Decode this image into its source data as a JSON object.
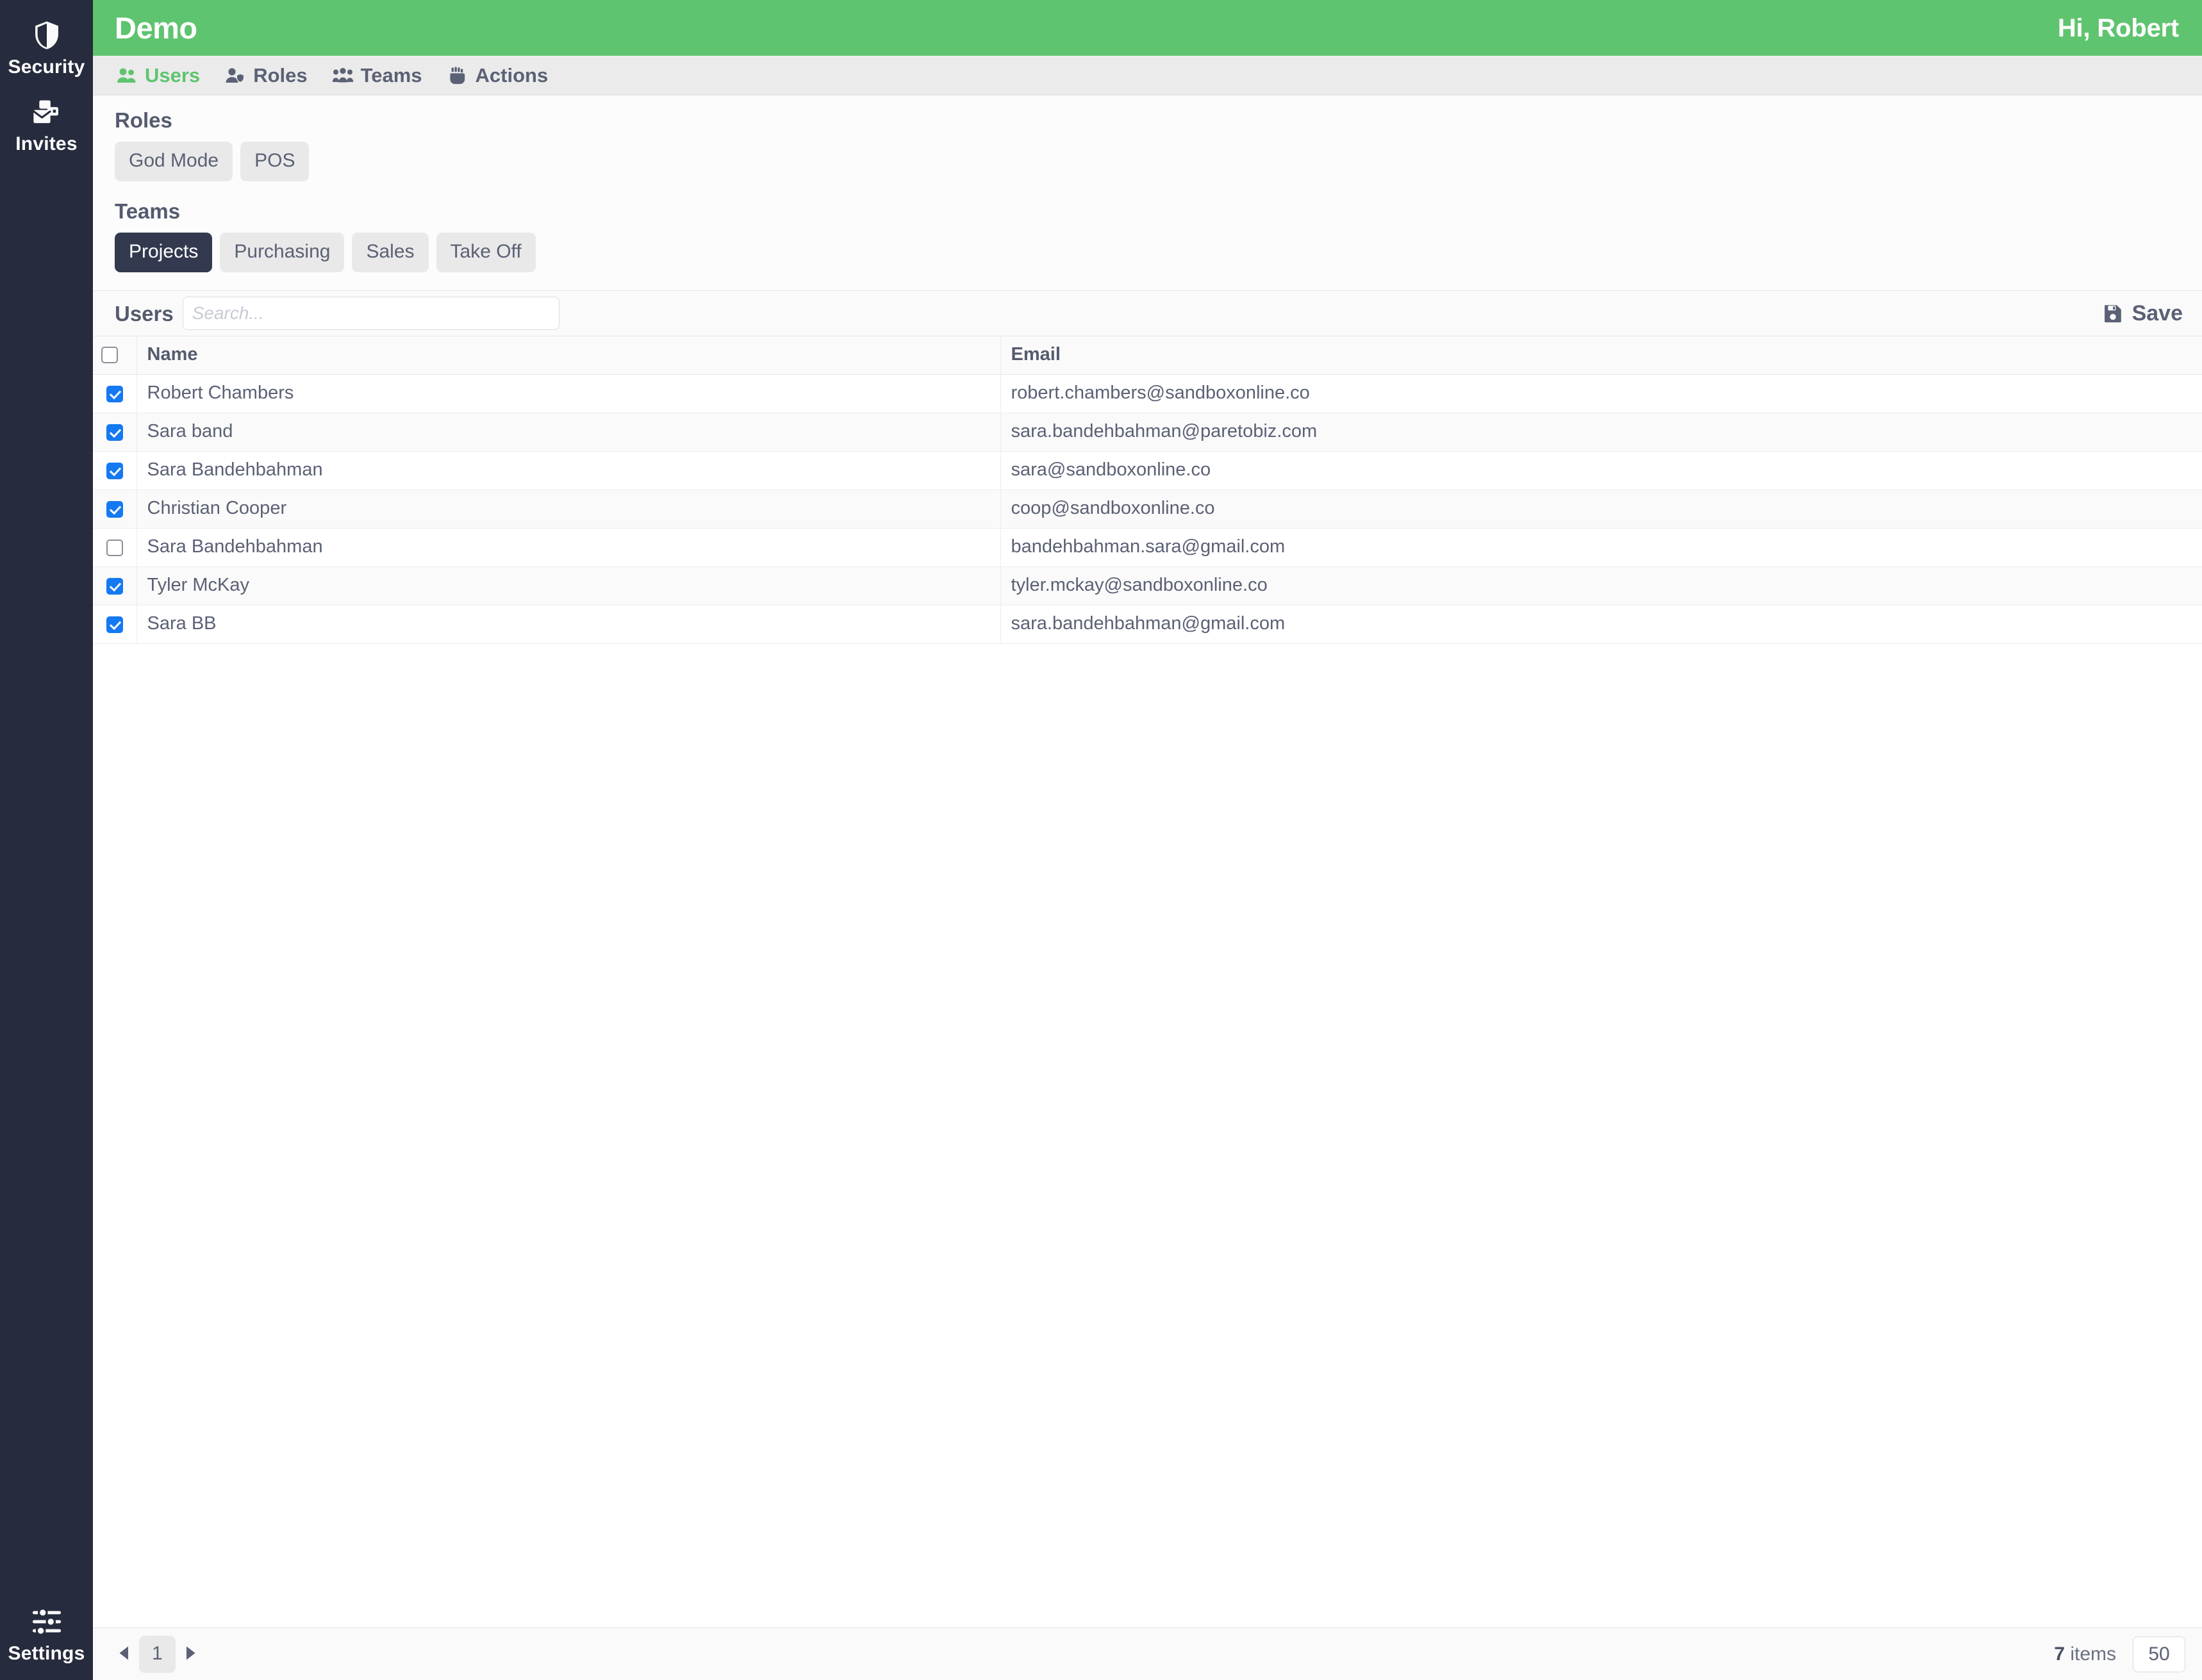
{
  "rail": {
    "items": [
      {
        "label": "Security",
        "icon": "shield-icon"
      },
      {
        "label": "Invites",
        "icon": "envelope-cards-icon"
      }
    ],
    "bottom": {
      "label": "Settings",
      "icon": "sliders-icon"
    }
  },
  "topbar": {
    "brand": "Demo",
    "greeting": "Hi, Robert"
  },
  "tabs": [
    {
      "label": "Users",
      "icon": "users-icon",
      "active": true
    },
    {
      "label": "Roles",
      "icon": "user-shield-icon",
      "active": false
    },
    {
      "label": "Teams",
      "icon": "people-group-icon",
      "active": false
    },
    {
      "label": "Actions",
      "icon": "raised-fist-icon",
      "active": false
    }
  ],
  "roles": {
    "title": "Roles",
    "chips": [
      {
        "label": "God Mode",
        "selected": false
      },
      {
        "label": "POS",
        "selected": false
      }
    ]
  },
  "teams": {
    "title": "Teams",
    "chips": [
      {
        "label": "Projects",
        "selected": true
      },
      {
        "label": "Purchasing",
        "selected": false
      },
      {
        "label": "Sales",
        "selected": false
      },
      {
        "label": "Take Off",
        "selected": false
      }
    ]
  },
  "toolbar": {
    "users_label": "Users",
    "search_value": "",
    "search_placeholder": "Search...",
    "save_label": "Save",
    "save_icon": "floppy-disk-icon"
  },
  "table": {
    "columns": [
      "Name",
      "Email"
    ],
    "select_all_checked": false,
    "rows": [
      {
        "checked": true,
        "name": "Robert Chambers",
        "email": "robert.chambers@sandboxonline.co"
      },
      {
        "checked": true,
        "name": "Sara band",
        "email": "sara.bandehbahman@paretobiz.com"
      },
      {
        "checked": true,
        "name": "Sara Bandehbahman",
        "email": "sara@sandboxonline.co"
      },
      {
        "checked": true,
        "name": "Christian Cooper",
        "email": "coop@sandboxonline.co"
      },
      {
        "checked": false,
        "name": "Sara Bandehbahman",
        "email": "bandehbahman.sara@gmail.com"
      },
      {
        "checked": true,
        "name": "Tyler McKay",
        "email": "tyler.mckay@sandboxonline.co"
      },
      {
        "checked": true,
        "name": "Sara BB",
        "email": "sara.bandehbahman@gmail.com"
      }
    ]
  },
  "pager": {
    "prev_icon": "triangle-left-icon",
    "next_icon": "triangle-right-icon",
    "current_page": "1",
    "item_count": "7",
    "item_count_suffix": "items",
    "page_size": "50"
  },
  "colors": {
    "brand_green": "#5FC46F",
    "rail_dark": "#262B3D",
    "chip_selected": "#333A4F",
    "checkbox_blue": "#1579F2",
    "text_slate": "#5B6175"
  }
}
